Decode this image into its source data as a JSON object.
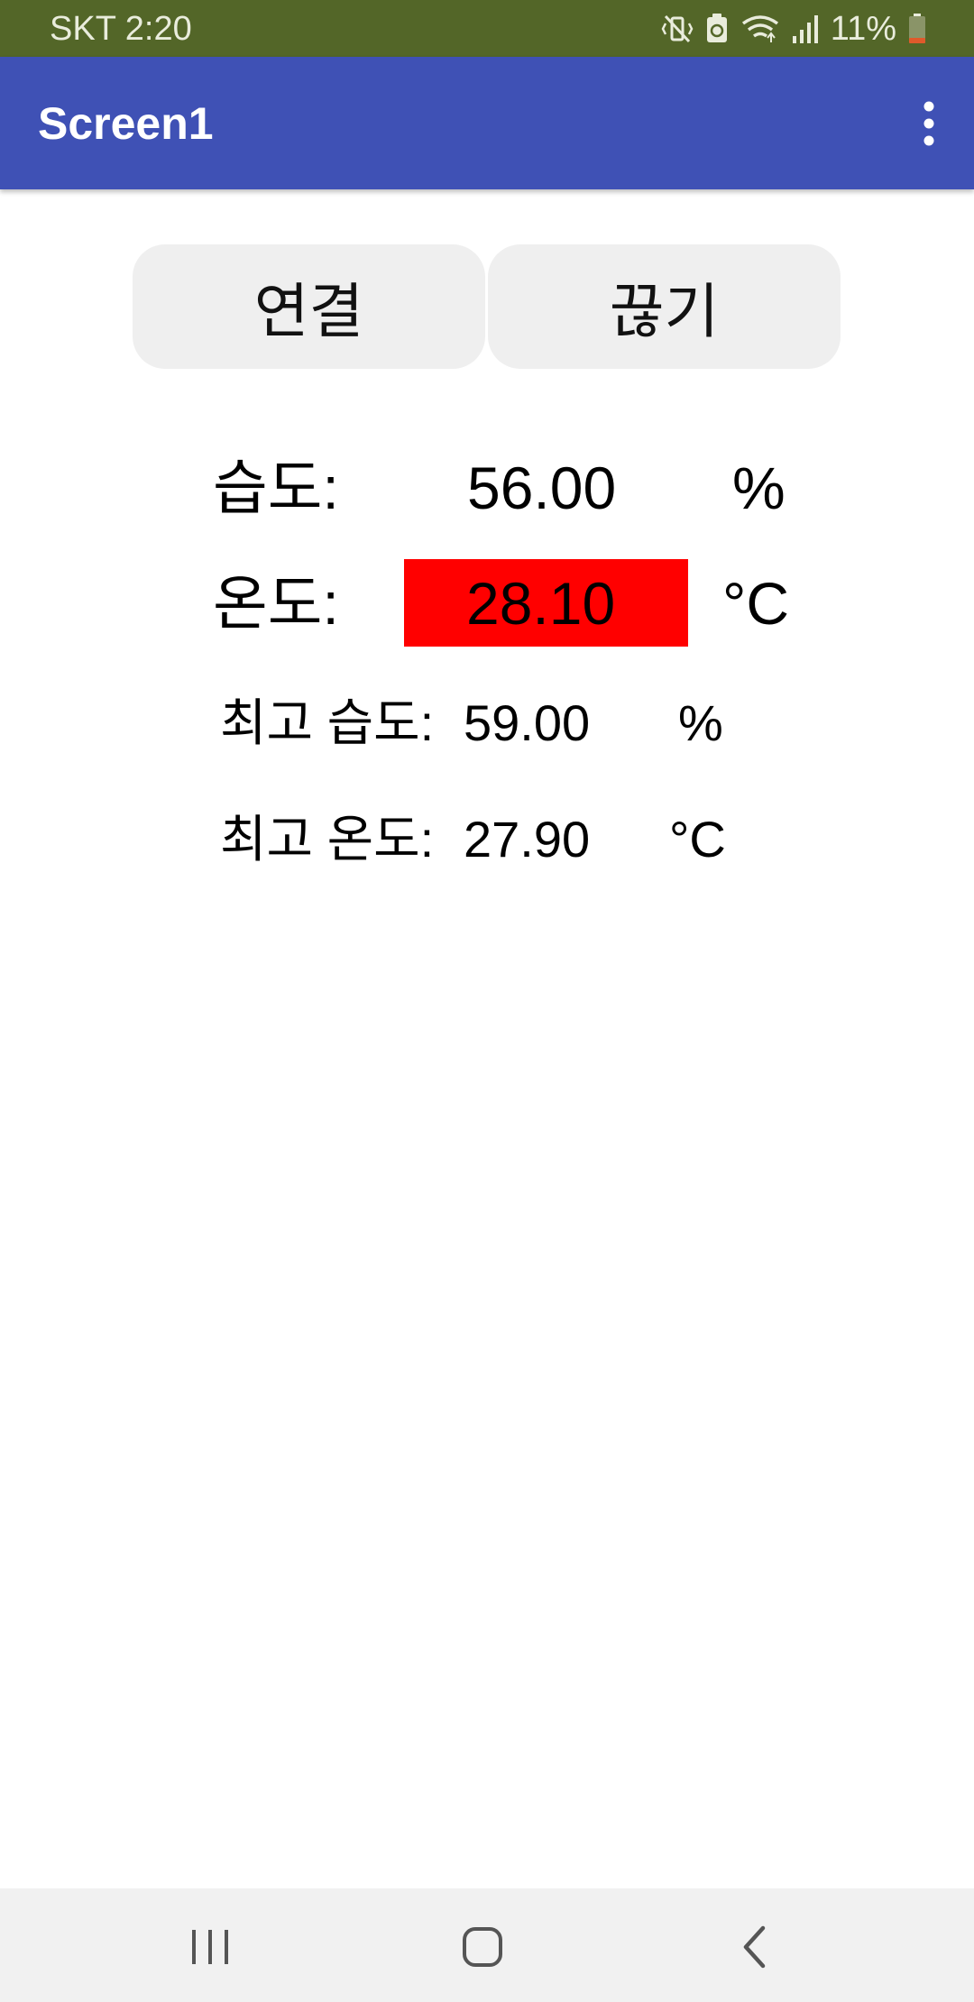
{
  "status_bar": {
    "carrier_time": "SKT 2:20",
    "battery_text": "11%",
    "icons": [
      "vibrate-mute-icon",
      "battery-saver-icon",
      "wifi-icon",
      "signal-icon",
      "battery-icon"
    ],
    "bar_color": "#536628"
  },
  "app_bar": {
    "title": "Screen1",
    "color": "#3f51b5"
  },
  "buttons": {
    "connect_label": "연결",
    "disconnect_label": "끊기"
  },
  "readings": {
    "humidity_label": "습도:",
    "humidity_value": "56.00",
    "humidity_unit": "%",
    "temperature_label": "온도:",
    "temperature_value": "28.10",
    "temperature_unit": "°C",
    "temperature_highlight_color": "#ff0000",
    "max_humidity_label": "최고 습도:",
    "max_humidity_value": "59.00",
    "max_humidity_unit": "%",
    "max_temperature_label": "최고 온도:",
    "max_temperature_value": "27.90",
    "max_temperature_unit": "°C"
  },
  "nav_bar": {
    "icons": [
      "recents-icon",
      "home-icon",
      "back-icon"
    ]
  }
}
